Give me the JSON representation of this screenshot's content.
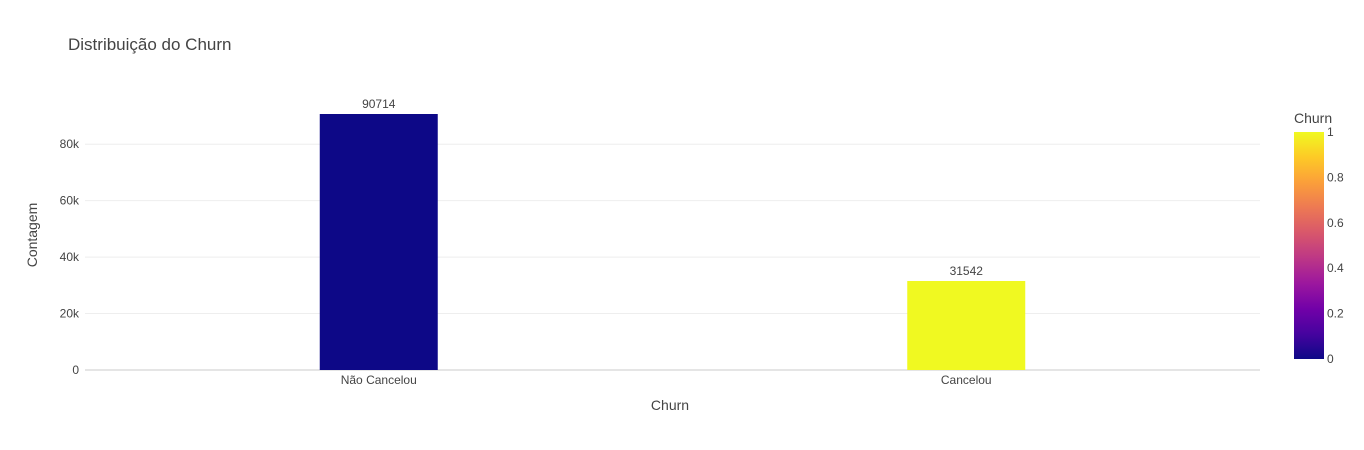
{
  "chart_data": {
    "type": "bar",
    "title": "Distribuição do Churn",
    "xlabel": "Churn",
    "ylabel": "Contagem",
    "categories": [
      "Não Cancelou",
      "Cancelou"
    ],
    "values": [
      90714,
      31542
    ],
    "data_labels": [
      "90714",
      "31542"
    ],
    "color_values": [
      0,
      1
    ],
    "ylim": [
      0,
      95000
    ],
    "y_ticks": [
      0,
      20000,
      40000,
      60000,
      80000
    ],
    "y_tick_labels": [
      "0",
      "20k",
      "40k",
      "60k",
      "80k"
    ],
    "grid": true,
    "colorbar": {
      "title": "Churn",
      "range": [
        0,
        1
      ],
      "ticks": [
        0,
        0.2,
        0.4,
        0.6,
        0.8,
        1
      ],
      "tick_labels": [
        "0",
        "0.2",
        "0.4",
        "0.6",
        "0.8",
        "1"
      ],
      "colorscale": [
        "#0d0887",
        "#46039f",
        "#7201a8",
        "#9c179e",
        "#bd3786",
        "#d8576b",
        "#ed7953",
        "#fb9f3a",
        "#fdca26",
        "#f0f921"
      ]
    },
    "legend": "right"
  }
}
